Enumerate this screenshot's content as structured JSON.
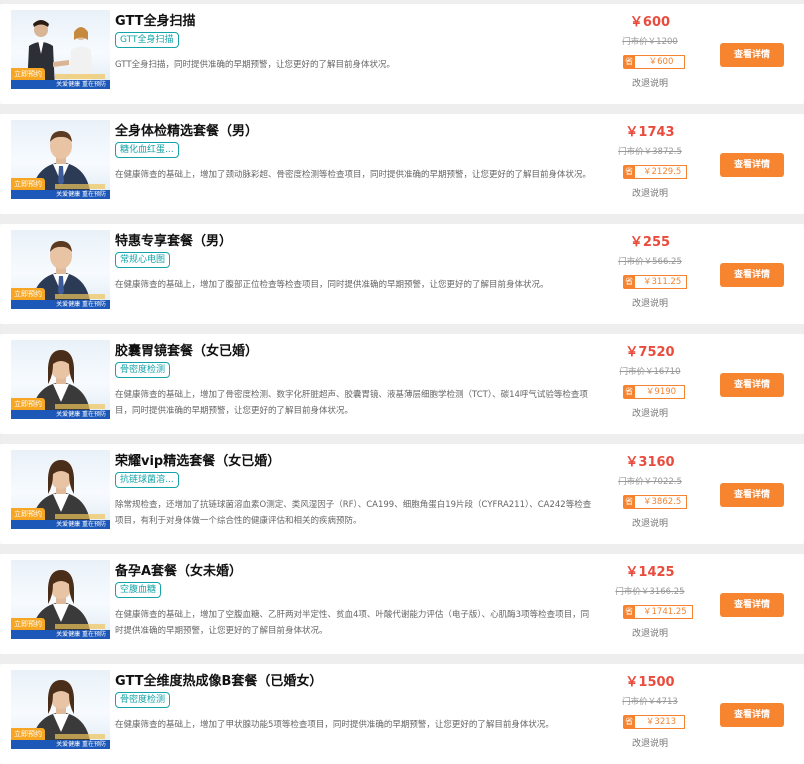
{
  "colors": {
    "accent_orange": "#f7852f",
    "price_red": "#e94b3c",
    "tag_teal": "#14a3a8",
    "slogan_blue": "#1d57b8",
    "reserve_yellow": "#f6a623"
  },
  "thumb_text": {
    "reserve": "立即预约",
    "slogan": "关爱健康  重在预防"
  },
  "labels": {
    "save_icon": "省",
    "change_note": "改退说明",
    "detail_button": "查看详情"
  },
  "packages": [
    {
      "title": "GTT全身扫描",
      "tag": "GTT全身扫描",
      "desc": "GTT全身扫描，同时提供准确的早期预警，让您更好的了解目前身体状况。",
      "price": "￥600",
      "market": "门市价￥1200",
      "save": "￥600",
      "figure": "pair"
    },
    {
      "title": "全身体检精选套餐（男）",
      "tag": "糖化血红蛋...",
      "desc": "在健康筛查的基础上，增加了颈动脉彩超、骨密度检测等检查项目，同时提供准确的早期预警，让您更好的了解目前身体状况。",
      "price": "￥1743",
      "market": "门市价￥3872.5",
      "save": "￥2129.5",
      "figure": "man"
    },
    {
      "title": "特惠专享套餐（男）",
      "tag": "常规心电图",
      "desc": "在健康筛查的基础上，增加了腹部正位检查等检查项目，同时提供准确的早期预警，让您更好的了解目前身体状况。",
      "price": "￥255",
      "market": "门市价￥566.25",
      "save": "￥311.25",
      "figure": "man"
    },
    {
      "title": "胶囊胃镜套餐（女已婚）",
      "tag": "骨密度检测",
      "desc": "在健康筛查的基础上，增加了骨密度检测、数字化肝脏超声、胶囊胃镜、液基薄层细胞学检测（TCT）、碳14呼气试验等检查项目，同时提供准确的早期预警，让您更好的了解目前身体状况。",
      "price": "￥7520",
      "market": "门市价￥16710",
      "save": "￥9190",
      "figure": "woman"
    },
    {
      "title": "荣耀vip精选套餐（女已婚）",
      "tag": "抗链球菌溶...",
      "desc": "除常规检查，还增加了抗链球菌溶血素O测定、类风湿因子（RF）、CA199、细胞角蛋白19片段（CYFRA211）、CA242等检查项目，有利于对身体做一个综合性的健康评估和相关的疾病预防。",
      "price": "￥3160",
      "market": "门市价￥7022.5",
      "save": "￥3862.5",
      "figure": "woman"
    },
    {
      "title": "备孕A套餐（女未婚）",
      "tag": "空腹血糖",
      "desc": "在健康筛查的基础上，增加了空腹血糖、乙肝两对半定性、贫血4项、叶酸代谢能力评估（电子版）、心肌酶3项等检查项目，同时提供准确的早期预警，让您更好的了解目前身体状况。",
      "price": "￥1425",
      "market": "门市价￥3166.25",
      "save": "￥1741.25",
      "figure": "woman"
    },
    {
      "title": "GTT全维度热成像B套餐（已婚女）",
      "tag": "骨密度检测",
      "desc": "在健康筛查的基础上，增加了甲状腺功能5项等检查项目，同时提供准确的早期预警，让您更好的了解目前身体状况。",
      "price": "￥1500",
      "market": "门市价￥4713",
      "save": "￥3213",
      "figure": "woman"
    }
  ]
}
